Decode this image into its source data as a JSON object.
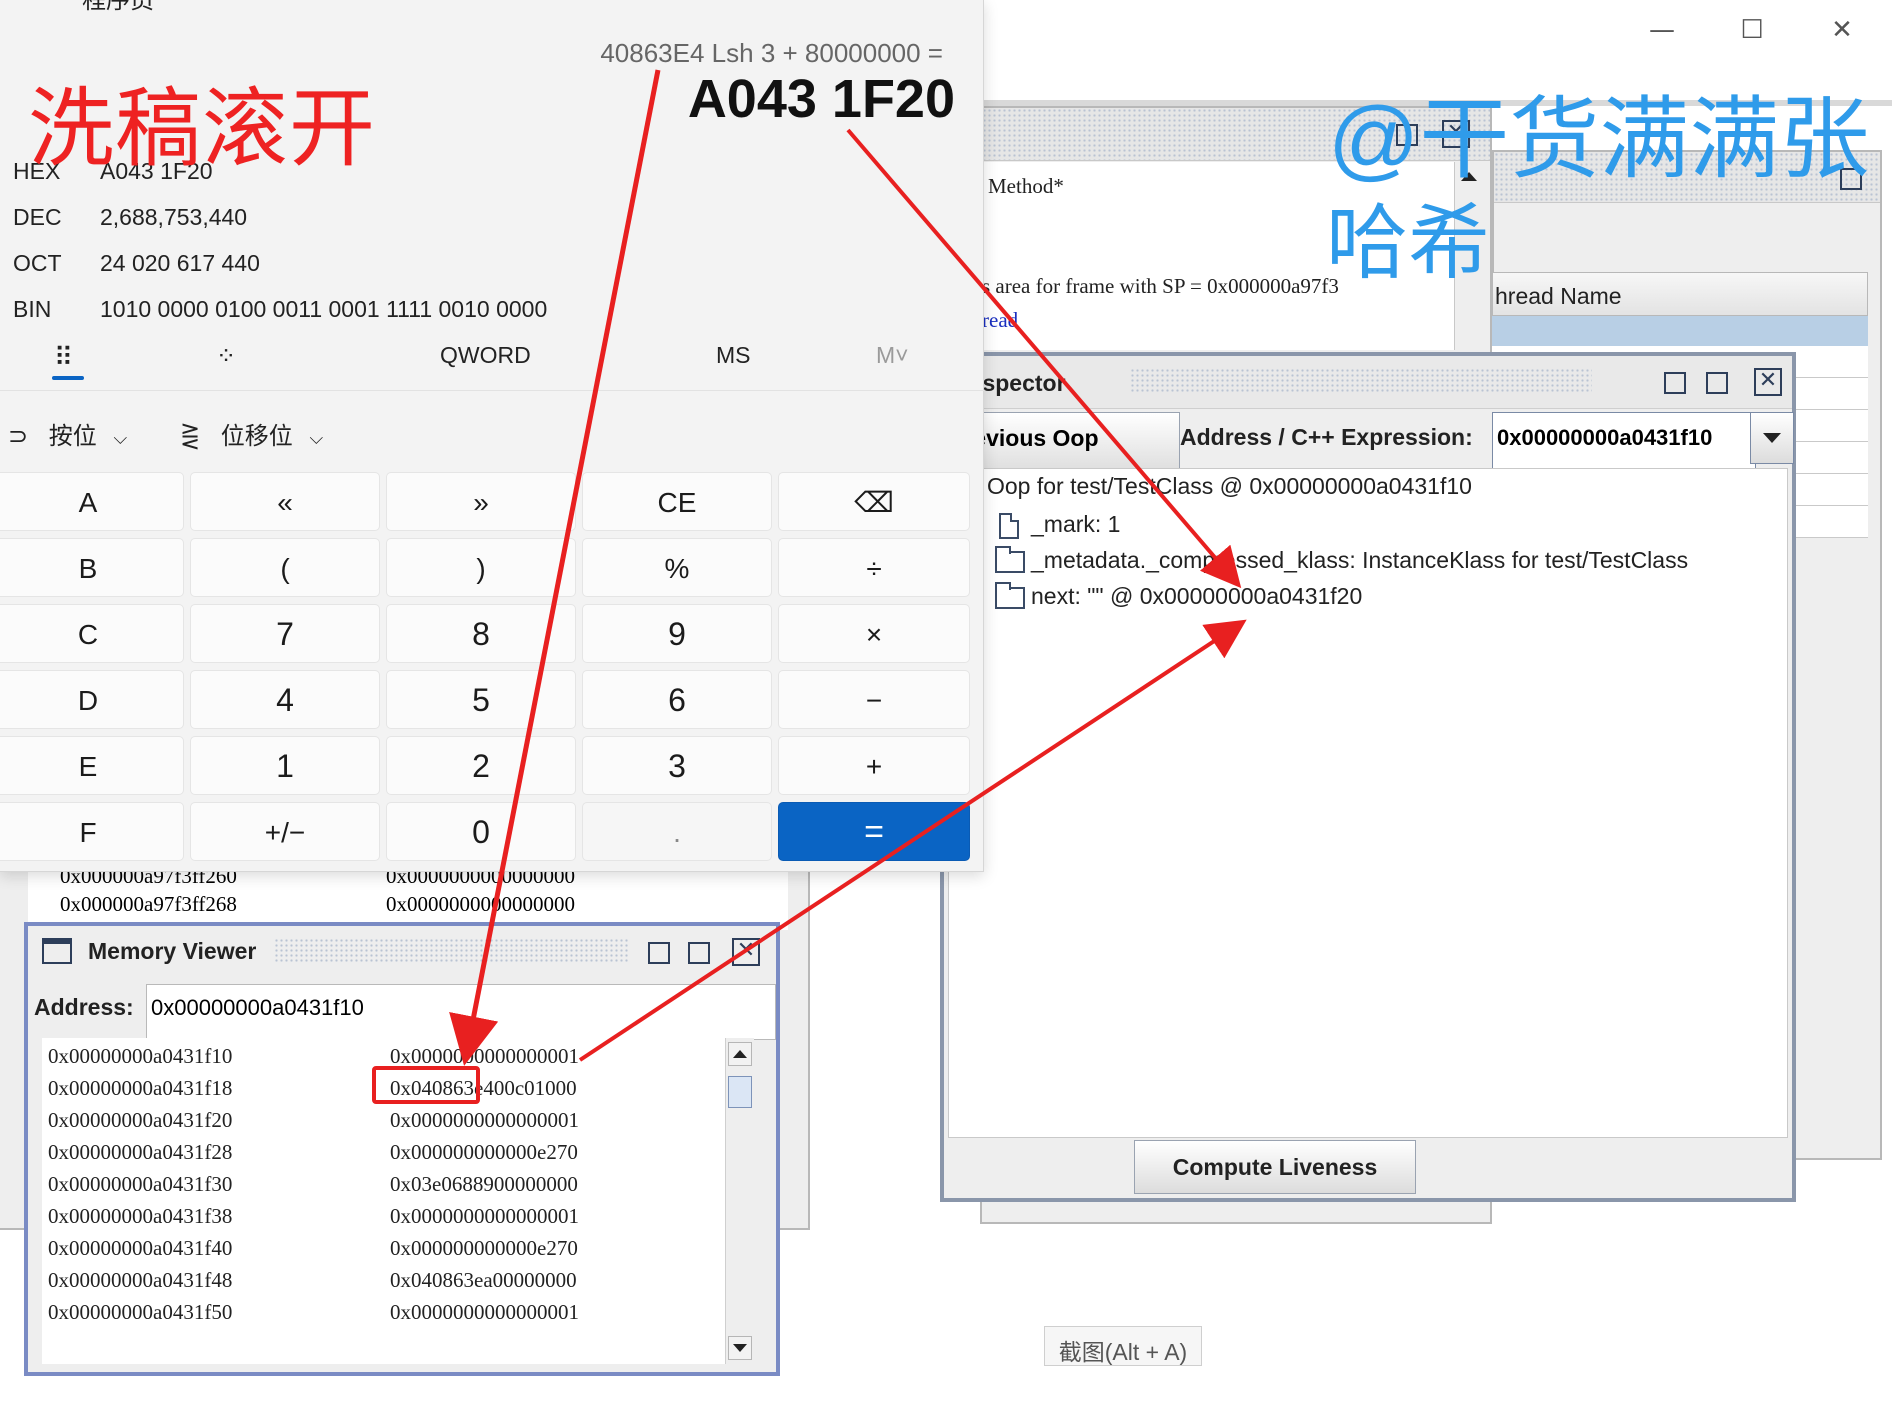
{
  "outer_window": {
    "minimize": "—",
    "maximize": "☐",
    "close": "✕"
  },
  "swing": {
    "text_lines": [
      "Method*",
      "s area for frame with SP = 0x000000a97f3",
      "read"
    ],
    "thread_header": "hread Name"
  },
  "inspector": {
    "title": "Inspector",
    "previous_button": "Previous Oop",
    "address_label": "Address / C++ Expression:",
    "address_value": "0x00000000a0431f10",
    "tree": [
      "Oop for test/TestClass @ 0x00000000a0431f10",
      "_mark: 1",
      "_metadata._compressed_klass: InstanceKlass for test/TestClass",
      "next: \"\" @ 0x00000000a0431f20"
    ],
    "compute_button": "Compute Liveness"
  },
  "behind_list": [
    {
      "addr": "0x000000a97f3ff260",
      "val": "0x0000000000000000"
    },
    {
      "addr": "0x000000a97f3ff268",
      "val": "0x0000000000000000"
    }
  ],
  "memory_viewer": {
    "title": "Memory Viewer",
    "address_label": "Address:",
    "address_value": "0x00000000a0431f10",
    "rows": [
      {
        "addr": "0x00000000a0431f10",
        "val": "0x0000000000000001"
      },
      {
        "addr": "0x00000000a0431f18",
        "val": "0x040863e400c01000"
      },
      {
        "addr": "0x00000000a0431f20",
        "val": "0x0000000000000001"
      },
      {
        "addr": "0x00000000a0431f28",
        "val": "0x000000000000e270"
      },
      {
        "addr": "0x00000000a0431f30",
        "val": "0x03e0688900000000"
      },
      {
        "addr": "0x00000000a0431f38",
        "val": "0x0000000000000001"
      },
      {
        "addr": "0x00000000a0431f40",
        "val": "0x000000000000e270"
      },
      {
        "addr": "0x00000000a0431f48",
        "val": "0x040863ea00000000"
      },
      {
        "addr": "0x00000000a0431f50",
        "val": "0x0000000000000001"
      }
    ]
  },
  "calculator": {
    "title": "程序员",
    "expression": "40863E4 Lsh 3 + 80000000 =",
    "result": "A043 1F20",
    "radix": [
      {
        "label": "HEX",
        "value": "A043 1F20"
      },
      {
        "label": "DEC",
        "value": "2,688,753,440"
      },
      {
        "label": "OCT",
        "value": "24 020 617 440"
      },
      {
        "label": "BIN",
        "value": "1010 0000 0100 0011 0001 1111 0010 0000"
      }
    ],
    "word_size": "QWORD",
    "ms": "MS",
    "m_menu": "M˅",
    "bitwise": "按位",
    "bitshift": "位移位",
    "keys": [
      [
        "A",
        "«",
        "»",
        "CE",
        "⌫"
      ],
      [
        "B",
        "(",
        ")",
        "%",
        "÷"
      ],
      [
        "C",
        "7",
        "8",
        "9",
        "×"
      ],
      [
        "D",
        "4",
        "5",
        "6",
        "−"
      ],
      [
        "E",
        "1",
        "2",
        "3",
        "+"
      ],
      [
        "F",
        "+/−",
        "0",
        ".",
        "="
      ]
    ]
  },
  "watermarks": {
    "red": "洗稿滚开",
    "blue_line1": "@干货满满张",
    "blue_line2": "哈希"
  },
  "snip_hint": "截图(Alt + A)",
  "colors": {
    "accent": "#0a64c4",
    "annotation": "#e82020",
    "watermark_blue": "#2f9bea"
  }
}
